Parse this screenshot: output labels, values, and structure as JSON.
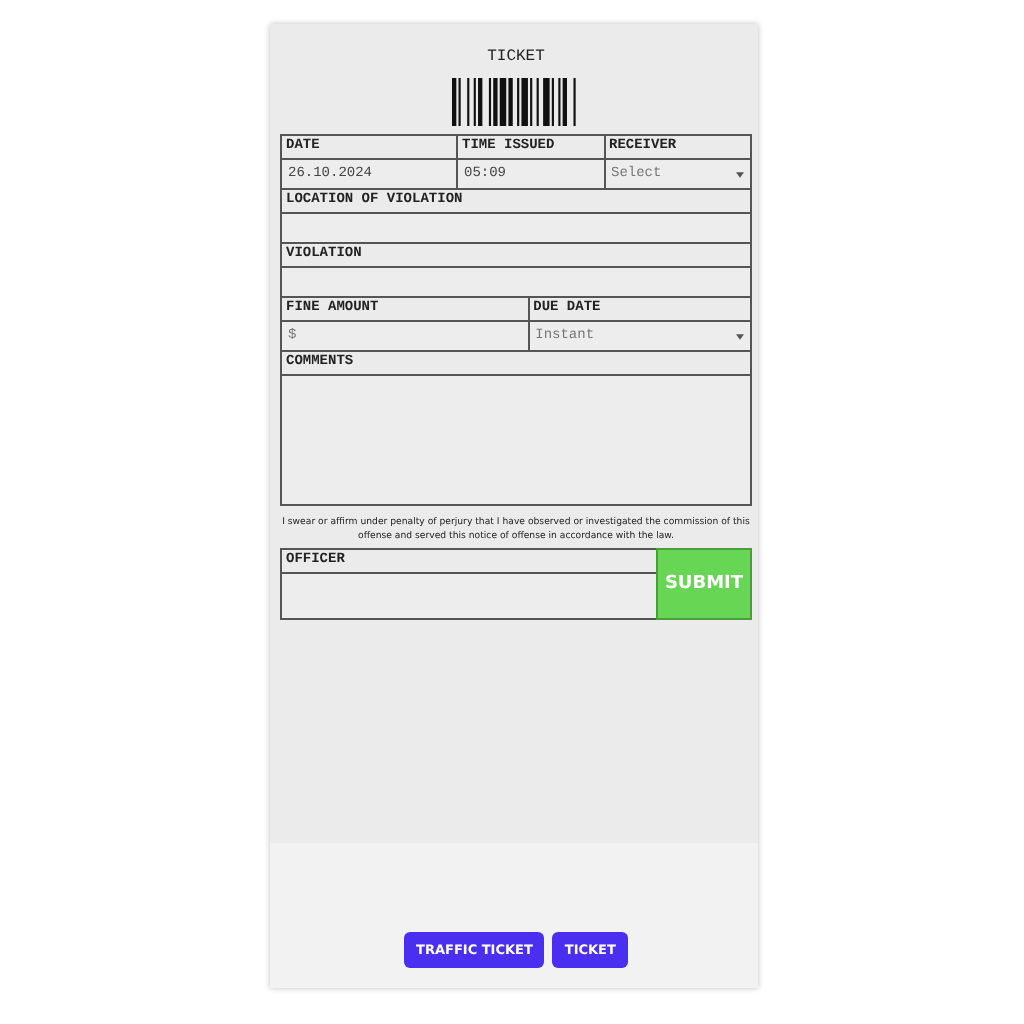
{
  "title": "TICKET",
  "date": {
    "label": "DATE",
    "value": "26.10.2024"
  },
  "time_issued": {
    "label": "TIME ISSUED",
    "value": "05:09"
  },
  "receiver": {
    "label": "RECEIVER",
    "placeholder": "Select"
  },
  "location": {
    "label": "LOCATION OF VIOLATION"
  },
  "violation": {
    "label": "VIOLATION"
  },
  "fine_amount": {
    "label": "FINE AMOUNT",
    "placeholder": "$"
  },
  "due_date": {
    "label": "DUE DATE",
    "value": "Instant"
  },
  "comments": {
    "label": "COMMENTS"
  },
  "oath": "I swear or affirm under penalty of perjury that I have observed or investigated the commission of this offense and served this notice of offense in accordance with the law.",
  "officer": {
    "label": "OFFICER"
  },
  "submit": "SUBMIT",
  "tabs": [
    {
      "label": "TRAFFIC TICKET"
    },
    {
      "label": "TICKET"
    }
  ]
}
